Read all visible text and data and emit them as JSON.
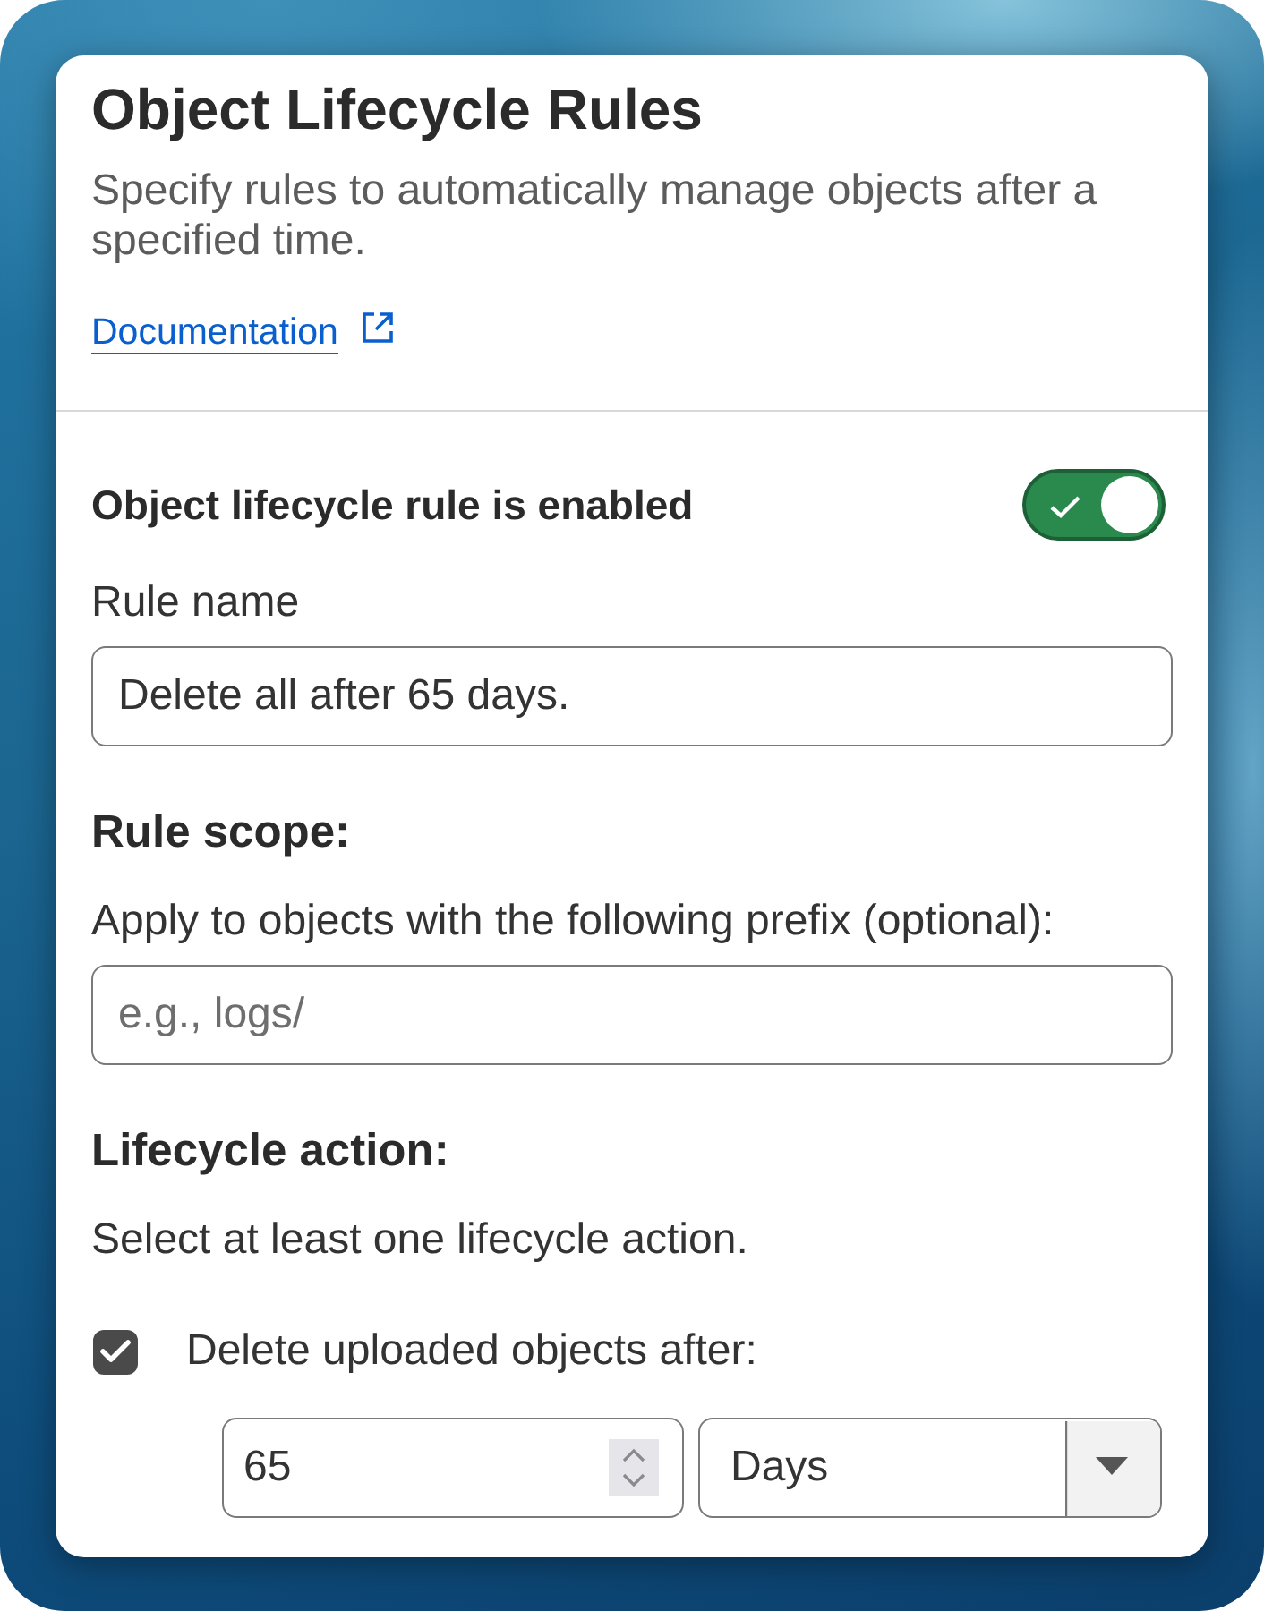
{
  "header": {
    "title": "Object Lifecycle Rules",
    "description": "Specify rules to automatically manage objects after a specified time.",
    "link": {
      "label": "Documentation"
    }
  },
  "enable_toggle": {
    "label": "Object lifecycle rule is enabled",
    "on": true
  },
  "rule_name": {
    "label": "Rule name",
    "value": "Delete all after 65 days."
  },
  "rule_scope": {
    "heading": "Rule scope:",
    "label": "Apply to objects with the following prefix (optional):",
    "placeholder": "e.g., logs/"
  },
  "lifecycle_action": {
    "heading": "Lifecycle action:",
    "hint": "Select at least one lifecycle action.",
    "actions": [
      {
        "label": "Delete uploaded objects after:",
        "checked": true,
        "amount": "65",
        "unit": "Days"
      }
    ]
  }
}
